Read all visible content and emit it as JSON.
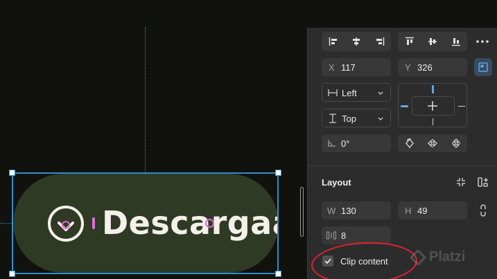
{
  "canvas": {
    "button_text": "Descargaaa",
    "button_fill": "#2f3a24",
    "selection_color": "#2d8fd0",
    "icon": "download-circle-icon"
  },
  "panel": {
    "alignment": {
      "horizontal": [
        "align-left-icon",
        "align-horizontal-center-icon",
        "align-right-icon"
      ],
      "vertical": [
        "align-top-icon",
        "align-vertical-center-icon",
        "align-bottom-icon"
      ],
      "more_icon": "more-icon"
    },
    "position": {
      "x_label": "X",
      "x_value": "117",
      "y_label": "Y",
      "y_value": "326"
    },
    "constraints": {
      "horizontal": "Left",
      "vertical": "Top"
    },
    "rotation": {
      "value": "0°"
    },
    "layout": {
      "title": "Layout",
      "w_label": "W",
      "w_value": "130",
      "h_label": "H",
      "h_value": "49",
      "gap_value": "8",
      "clip_content_label": "Clip content",
      "clip_content_checked": true
    },
    "watermark": "Platzi"
  }
}
